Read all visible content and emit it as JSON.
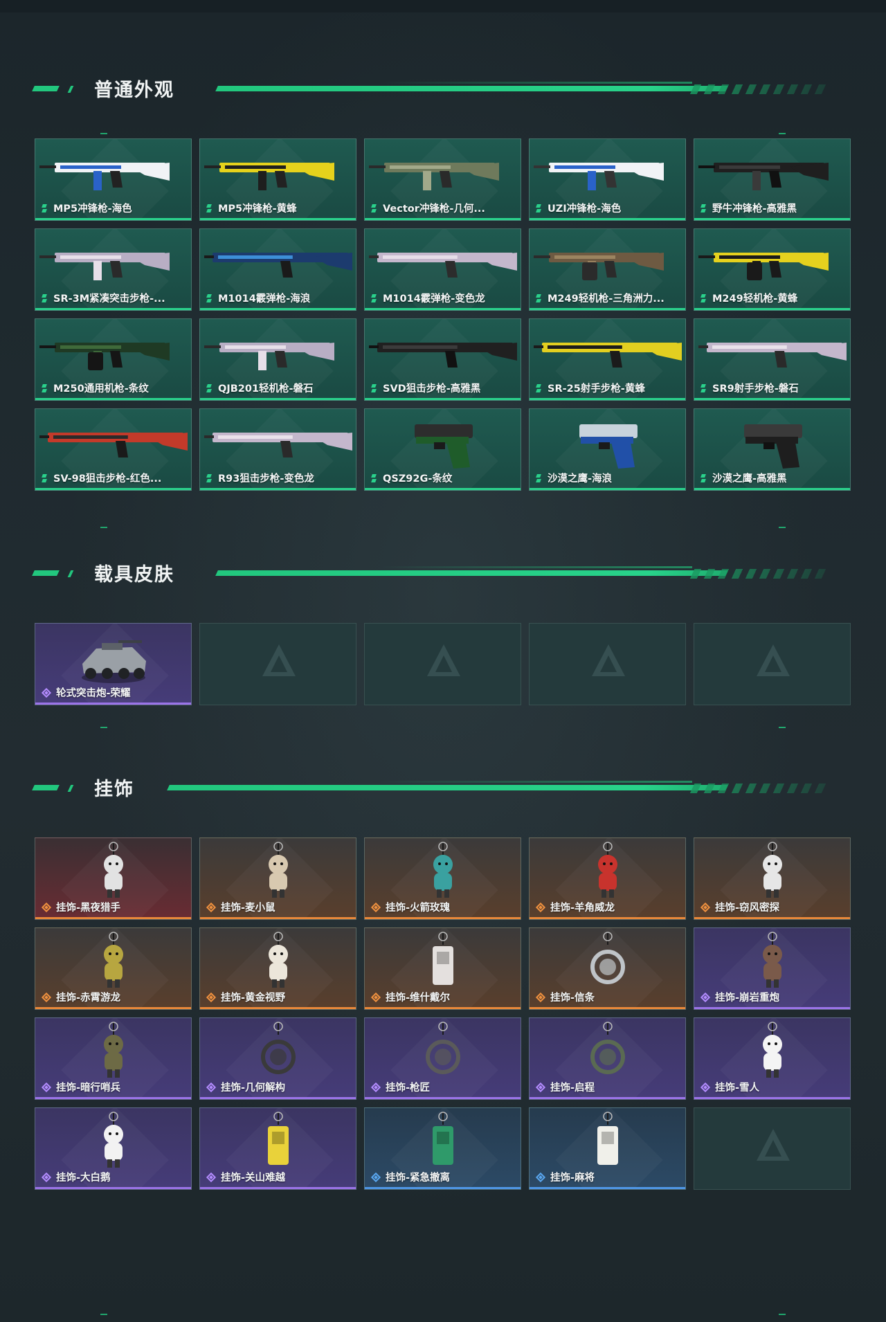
{
  "sections": [
    {
      "title": "普通外观",
      "items": [
        {
          "name": "MP5冲锋枪-海色",
          "rarity": "green",
          "art": "smg-white"
        },
        {
          "name": "MP5冲锋枪-黄蜂",
          "rarity": "green",
          "art": "smg-yellow"
        },
        {
          "name": "Vector冲锋枪-几何...",
          "rarity": "green",
          "art": "vector-camo"
        },
        {
          "name": "UZI冲锋枪-海色",
          "rarity": "green",
          "art": "uzi-white"
        },
        {
          "name": "野牛冲锋枪-高雅黑",
          "rarity": "green",
          "art": "bizon-black"
        },
        {
          "name": "SR-3M紧凑突击步枪-...",
          "rarity": "green",
          "art": "rifle-pink"
        },
        {
          "name": "M1014霰弹枪-海浪",
          "rarity": "green",
          "art": "shotgun-blue"
        },
        {
          "name": "M1014霰弹枪-变色龙",
          "rarity": "green",
          "art": "shotgun-pink"
        },
        {
          "name": "M249轻机枪-三角洲力...",
          "rarity": "green",
          "art": "lmg-desert"
        },
        {
          "name": "M249轻机枪-黄蜂",
          "rarity": "green",
          "art": "lmg-yellow"
        },
        {
          "name": "M250通用机枪-条纹",
          "rarity": "green",
          "art": "lmg-green"
        },
        {
          "name": "QJB201轻机枪-磐石",
          "rarity": "green",
          "art": "rifle-pink"
        },
        {
          "name": "SVD狙击步枪-高雅黑",
          "rarity": "green",
          "art": "sniper-black"
        },
        {
          "name": "SR-25射手步枪-黄蜂",
          "rarity": "green",
          "art": "sniper-yellow"
        },
        {
          "name": "SR9射手步枪-磐石",
          "rarity": "green",
          "art": "sniper-pink"
        },
        {
          "name": "SV-98狙击步枪-红色...",
          "rarity": "green",
          "art": "sniper-red"
        },
        {
          "name": "R93狙击步枪-变色龙",
          "rarity": "green",
          "art": "sniper-pink"
        },
        {
          "name": "QSZ92G-条纹",
          "rarity": "green",
          "art": "pistol-green"
        },
        {
          "name": "沙漠之鹰-海浪",
          "rarity": "green",
          "art": "pistol-blue"
        },
        {
          "name": "沙漠之鹰-高雅黑",
          "rarity": "green",
          "art": "pistol-black"
        }
      ]
    },
    {
      "title": "载具皮肤",
      "items": [
        {
          "name": "轮式突击炮-荣耀",
          "rarity": "purple",
          "art": "vehicle"
        },
        {
          "empty": true
        },
        {
          "empty": true
        },
        {
          "empty": true
        },
        {
          "empty": true
        }
      ]
    },
    {
      "title": "挂饰",
      "items": [
        {
          "name": "挂饰-黑夜猎手",
          "rarity": "red",
          "art": "charm-figure",
          "tint": "#e2e2e2"
        },
        {
          "name": "挂饰-麦小鼠",
          "rarity": "orange",
          "art": "charm-figure",
          "tint": "#d8c9b0"
        },
        {
          "name": "挂饰-火箭玫瑰",
          "rarity": "orange",
          "art": "charm-figure",
          "tint": "#3aa1a0"
        },
        {
          "name": "挂饰-羊角威龙",
          "rarity": "orange",
          "art": "charm-figure",
          "tint": "#c8332d"
        },
        {
          "name": "挂饰-窃风密探",
          "rarity": "orange",
          "art": "charm-figure",
          "tint": "#e6e6e6"
        },
        {
          "name": "挂饰-赤霄游龙",
          "rarity": "orange",
          "art": "charm-figure",
          "tint": "#b7a640"
        },
        {
          "name": "挂饰-黄金视野",
          "rarity": "orange",
          "art": "charm-figure",
          "tint": "#ece6da"
        },
        {
          "name": "挂饰-维什戴尔",
          "rarity": "orange",
          "art": "charm-tag",
          "tint": "#e4e0de"
        },
        {
          "name": "挂饰-信条",
          "rarity": "orange",
          "art": "charm-ring",
          "tint": "#bfc4c8"
        },
        {
          "name": "挂饰-崩岩重炮",
          "rarity": "purple",
          "art": "charm-figure",
          "tint": "#7a5a4a"
        },
        {
          "name": "挂饰-暗行哨兵",
          "rarity": "purple",
          "art": "charm-figure",
          "tint": "#6d6a45"
        },
        {
          "name": "挂饰-几何解构",
          "rarity": "purple",
          "art": "charm-ring",
          "tint": "#3a3a3a"
        },
        {
          "name": "挂饰-枪匠",
          "rarity": "purple",
          "art": "charm-ring",
          "tint": "#5a5a5a"
        },
        {
          "name": "挂饰-启程",
          "rarity": "purple",
          "art": "charm-ring",
          "tint": "#5a6a52"
        },
        {
          "name": "挂饰-雪人",
          "rarity": "purple",
          "art": "charm-figure",
          "tint": "#f4f4f4"
        },
        {
          "name": "挂饰-大白鹅",
          "rarity": "purple",
          "art": "charm-figure",
          "tint": "#f2f2f2"
        },
        {
          "name": "挂饰-关山难越",
          "rarity": "purple",
          "art": "charm-tag",
          "tint": "#e9d23a"
        },
        {
          "name": "挂饰-紧急撤离",
          "rarity": "blue",
          "art": "charm-tag",
          "tint": "#2f9a6a"
        },
        {
          "name": "挂饰-麻将",
          "rarity": "blue",
          "art": "charm-tag",
          "tint": "#f0f0ea"
        },
        {
          "empty": true
        }
      ]
    }
  ],
  "colors": {
    "accent": "#22c77e",
    "rarity_green": "#2ad28c",
    "rarity_purple": "#9b74e8",
    "rarity_orange": "#e8883a",
    "rarity_blue": "#4f97e6"
  }
}
